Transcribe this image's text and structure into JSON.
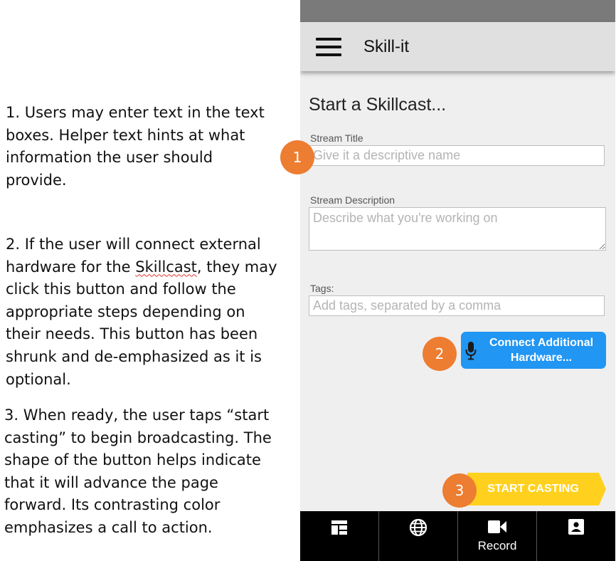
{
  "annotations": {
    "note1": "1. Users may enter text in the text boxes. Helper text hints at what information the user should provide.",
    "note2_before": "2. If the user will connect external hardware for the ",
    "note2_underlined": "Skillcast",
    "note2_after": ", they may click this button and follow the appropriate steps depending on their needs. This button has been shrunk and de-emphasized as it is optional.",
    "note3": "3. When ready, the user taps “start casting” to begin broadcasting. The shape of the button helps indicate that it will advance the page forward. Its contrasting color emphasizes a call to action."
  },
  "callouts": {
    "one": "1",
    "two": "2",
    "three": "3"
  },
  "app": {
    "title": "Skill-it",
    "menu_icon": "hamburger-menu-icon"
  },
  "form": {
    "heading": "Start a Skillcast...",
    "stream_title": {
      "label": "Stream Title",
      "placeholder": "Give it a descriptive name",
      "value": ""
    },
    "stream_description": {
      "label": "Stream Description",
      "placeholder": "Describe what you're working on",
      "value": ""
    },
    "tags": {
      "label": "Tags:",
      "placeholder": "Add tags, separated by a comma",
      "value": ""
    }
  },
  "hardware_button": {
    "label": "Connect Additional Hardware...",
    "icon": "microphone-icon"
  },
  "start_button": {
    "label": "START CASTING"
  },
  "bottom_nav": {
    "items": [
      {
        "icon": "dashboard-icon",
        "label": ""
      },
      {
        "icon": "globe-icon",
        "label": ""
      },
      {
        "icon": "video-camera-icon",
        "label": "Record"
      },
      {
        "icon": "account-box-icon",
        "label": ""
      }
    ]
  },
  "colors": {
    "accent_blue": "#2196f3",
    "call_to_action_yellow": "#ffd11e",
    "callout_orange": "#ed7d31",
    "status_bar": "#7a7a7a",
    "app_bar": "#e0e0e0",
    "nav_background": "#000000"
  }
}
